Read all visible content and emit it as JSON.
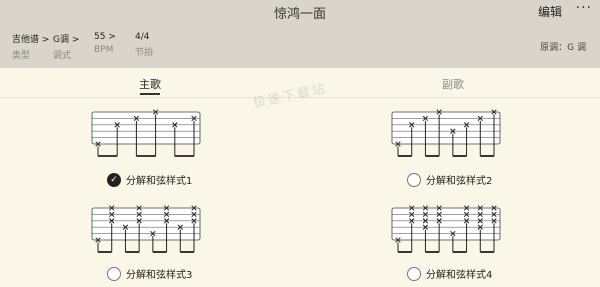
{
  "header": {
    "title": "惊鸿一面",
    "edit_label": "编辑",
    "more_label": "···",
    "meta": [
      {
        "value": "吉他谱 >",
        "label": "类型"
      },
      {
        "value": "G调 >",
        "label": "调式"
      },
      {
        "value": "55 >",
        "label": "BPM"
      },
      {
        "value": "4/4",
        "label": "节拍"
      }
    ],
    "original_key": "原调：G 调"
  },
  "tabs": [
    {
      "label": "主歌",
      "active": true
    },
    {
      "label": "副歌",
      "active": false
    }
  ],
  "watermark": "极速下载站",
  "options": [
    {
      "label": "分解和弦样式1",
      "selected": true,
      "beats": [
        [
          6
        ],
        [
          3
        ],
        [
          2
        ],
        [
          1
        ],
        [
          3
        ],
        [
          2
        ]
      ]
    },
    {
      "label": "分解和弦样式2",
      "selected": false,
      "beats": [
        [
          6
        ],
        [
          3
        ],
        [
          2
        ],
        [
          1
        ],
        [
          4
        ],
        [
          3
        ],
        [
          2
        ],
        [
          1
        ]
      ]
    },
    {
      "label": "分解和弦样式3",
      "selected": false,
      "beats": [
        [
          6
        ],
        [
          3,
          2,
          1
        ],
        [
          4
        ],
        [
          3,
          2,
          1
        ],
        [
          5
        ],
        [
          3,
          2,
          1
        ],
        [
          4
        ],
        [
          3,
          2,
          1
        ]
      ]
    },
    {
      "label": "分解和弦样式4",
      "selected": false,
      "beats": [
        [
          6
        ],
        [
          3,
          2,
          1
        ],
        [
          4,
          3,
          2,
          1
        ],
        [
          3,
          2,
          1
        ],
        [
          5
        ],
        [
          3,
          2,
          1
        ],
        [
          4,
          3,
          2,
          1
        ],
        [
          3,
          2,
          1
        ]
      ]
    }
  ],
  "icons": {
    "check": "check-icon",
    "radio": "radio-icon"
  }
}
